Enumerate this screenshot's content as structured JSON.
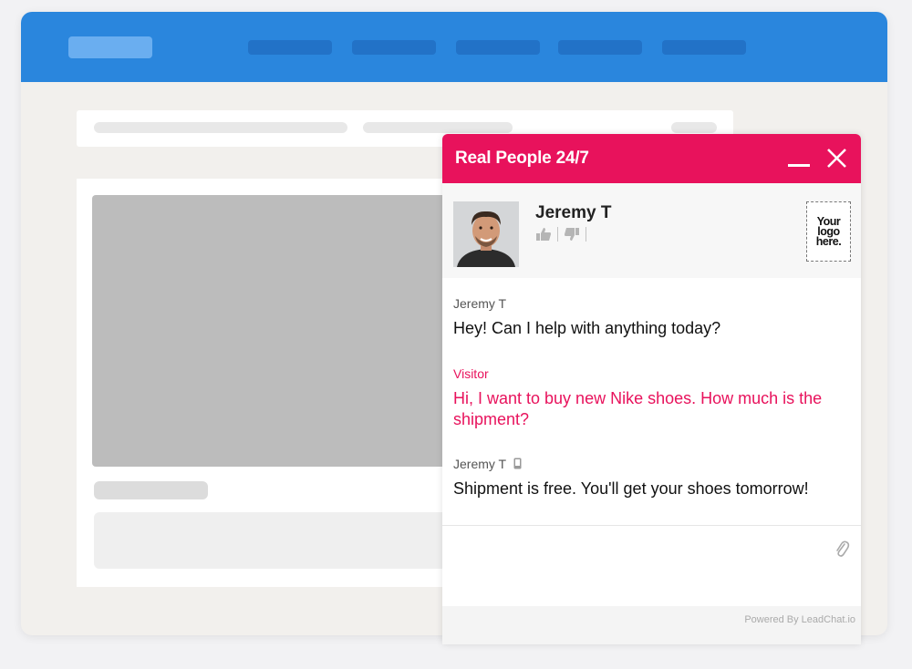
{
  "chat": {
    "title": "Real People 24/7",
    "agent": {
      "name": "Jeremy T"
    },
    "logo_placeholder": [
      "Your",
      "logo",
      "here."
    ],
    "messages": [
      {
        "author": "Jeremy T",
        "text": "Hey! Can I help with anything today?",
        "from": "agent"
      },
      {
        "author": "Visitor",
        "text": "Hi, I want to buy new Nike shoes. How much is the shipment?",
        "from": "visitor"
      },
      {
        "author": "Jeremy T",
        "text": "Shipment is free. You'll get your shoes tomorrow!",
        "from": "agent",
        "device_icon": "mobile-icon"
      }
    ],
    "powered_by": "Powered By LeadChat.io"
  },
  "icons": {
    "minimize": "minimize-icon",
    "close": "close-icon",
    "thumbs_up": "thumbs-up-icon",
    "thumbs_down": "thumbs-down-icon",
    "attach": "paperclip-icon"
  },
  "colors": {
    "brand_blue": "#2a86dd",
    "chat_accent": "#e8125c"
  }
}
